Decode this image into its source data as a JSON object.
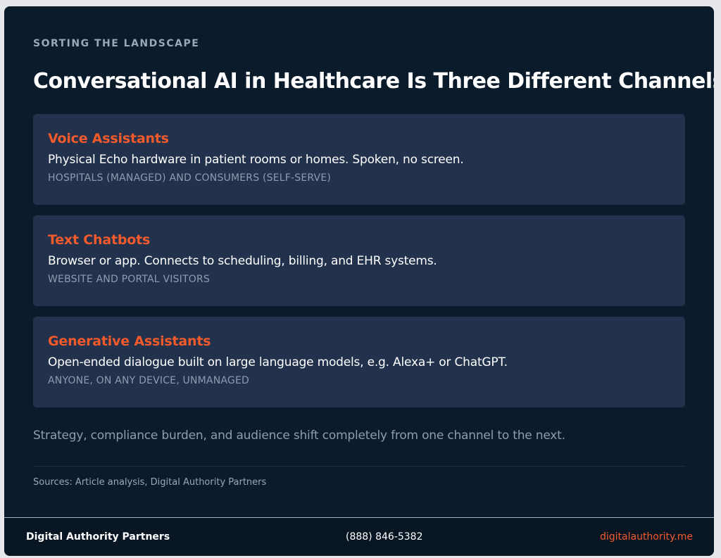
{
  "eyebrow": "SORTING THE LANDSCAPE",
  "title": "Conversational AI in Healthcare Is Three Different Channels",
  "cards": [
    {
      "title": "Voice Assistants",
      "description": "Physical Echo hardware in patient rooms or homes. Spoken, no screen.",
      "audience": "HOSPITALS (MANAGED) AND CONSUMERS (SELF-SERVE)"
    },
    {
      "title": "Text Chatbots",
      "description": "Browser or app. Connects to scheduling, billing, and EHR systems.",
      "audience": "WEBSITE AND PORTAL VISITORS"
    },
    {
      "title": "Generative Assistants",
      "description": "Open-ended dialogue built on large language models, e.g. Alexa+ or ChatGPT.",
      "audience": "ANYONE, ON ANY DEVICE, UNMANAGED"
    }
  ],
  "summary": "Strategy, compliance burden, and audience shift completely from one channel to the next.",
  "sources": "Sources: Article analysis, Digital Authority Partners",
  "footer": {
    "brand": "Digital Authority Partners",
    "phone": "(888) 846-5382",
    "website": "digitalauthority.me"
  },
  "colors": {
    "background": "#0a1b2b",
    "card": "#22314c",
    "accent": "#f25a2c",
    "muted": "#8f9cb0"
  }
}
